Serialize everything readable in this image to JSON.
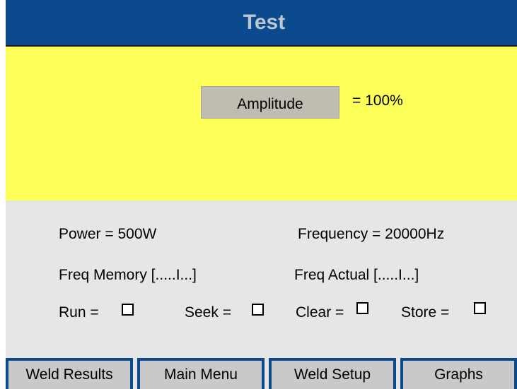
{
  "title": "Test",
  "amplitude": {
    "button_label": "Amplitude",
    "value_text": "= 100%"
  },
  "info": {
    "power": "Power = 500W",
    "frequency": "Frequency = 20000Hz",
    "freq_memory": "Freq Memory [.....I...]",
    "freq_actual": "Freq Actual [.....I...]"
  },
  "checks": {
    "run_label": "Run =",
    "run_checked": false,
    "seek_label": "Seek =",
    "seek_checked": false,
    "clear_label": "Clear =",
    "clear_checked": false,
    "store_label": "Store =",
    "store_checked": false
  },
  "tabs": [
    {
      "label": "Weld Results"
    },
    {
      "label": "Main Menu"
    },
    {
      "label": "Weld Setup"
    },
    {
      "label": "Graphs"
    }
  ],
  "colors": {
    "title_bar": "#0b4a8c",
    "title_text": "#bcc6d2",
    "panel_yellow": "#ffff59",
    "background_gray": "#e6e6e6",
    "button_gray": "#bfbdb2",
    "tab_gray": "#c9c9c9"
  }
}
